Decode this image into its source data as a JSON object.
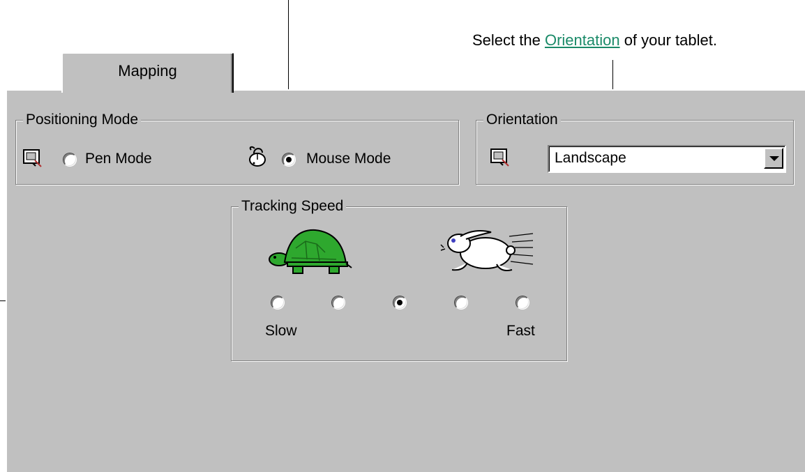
{
  "annotations": {
    "top_left_partial": "",
    "orientation_prefix": "Select the ",
    "orientation_link": "Orientation",
    "orientation_suffix": " of your tablet."
  },
  "tabs": [
    {
      "label": "Mapping",
      "selected": true
    }
  ],
  "positioning_mode": {
    "legend": "Positioning Mode",
    "options": [
      {
        "label": "Pen Mode",
        "icon": "tablet-icon",
        "checked": false
      },
      {
        "label": "Mouse Mode",
        "icon": "mouse-icon",
        "checked": true
      }
    ]
  },
  "orientation": {
    "legend": "Orientation",
    "icon": "tablet-icon",
    "selected": "Landscape"
  },
  "tracking_speed": {
    "legend": "Tracking Speed",
    "slow_icon": "turtle-icon",
    "fast_icon": "rabbit-icon",
    "levels": [
      false,
      false,
      true,
      false,
      false
    ],
    "slow_label": "Slow",
    "fast_label": "Fast"
  },
  "colors": {
    "dialog_face": "#c0c0c0",
    "link": "#1a8a68",
    "turtle_shell": "#2ea82e"
  }
}
